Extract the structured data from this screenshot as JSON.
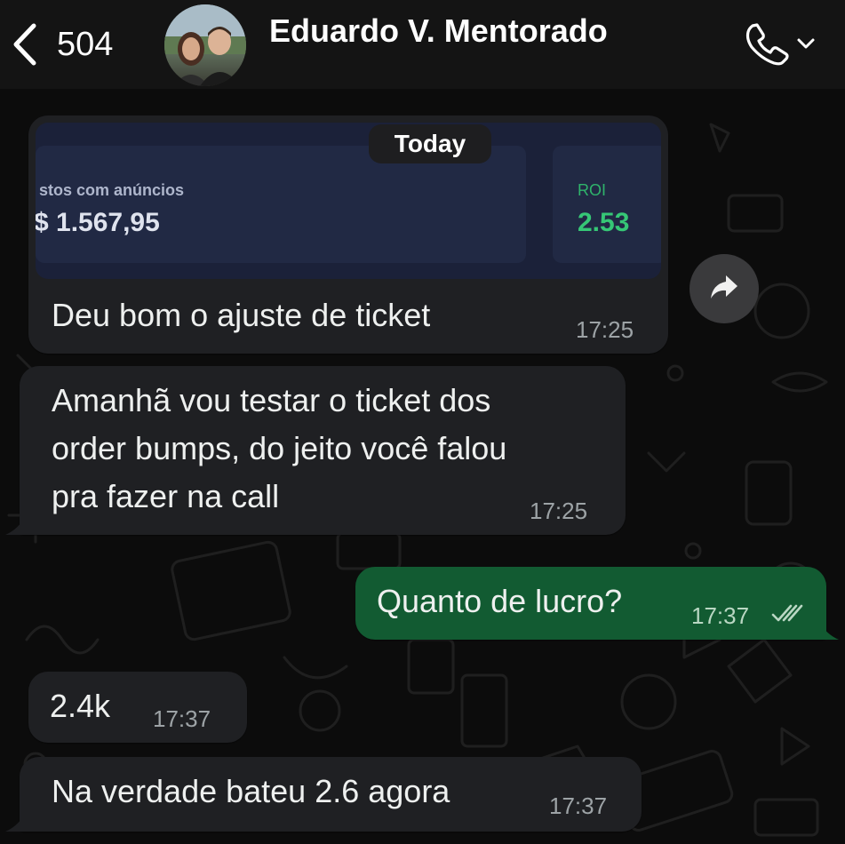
{
  "header": {
    "back_count": "504",
    "contact_name": "Eduardo V. Mentorado",
    "icons": {
      "back": "chevron-left-icon",
      "call": "phone-icon",
      "call_menu": "chevron-down-icon"
    }
  },
  "date_separator": "Today",
  "messages": [
    {
      "direction": "incoming",
      "image": {
        "card1_label": "stos com anúncios",
        "card1_value": "$ 1.567,95",
        "card2_label": "ROI",
        "card2_value": "2.53"
      },
      "text": "Deu bom o ajuste de ticket",
      "time": "17:25"
    },
    {
      "direction": "incoming",
      "lines": [
        "Amanhã vou testar o ticket dos",
        "order bumps, do jeito você falou",
        "pra fazer na call"
      ],
      "time": "17:25"
    },
    {
      "direction": "outgoing",
      "text": "Quanto de lucro?",
      "time": "17:37",
      "status": "read"
    },
    {
      "direction": "incoming",
      "text": "2.4k",
      "time": "17:37"
    },
    {
      "direction": "incoming",
      "text": "Na verdade bateu 2.6 agora",
      "time": "17:37"
    }
  ],
  "colors": {
    "header_bg": "#141414",
    "chat_bg": "#0c0c0c",
    "incoming_bubble": "#1f2023",
    "outgoing_bubble": "#125b32",
    "read_ticks": "#b9d7c3",
    "roi_green": "#36c776"
  }
}
